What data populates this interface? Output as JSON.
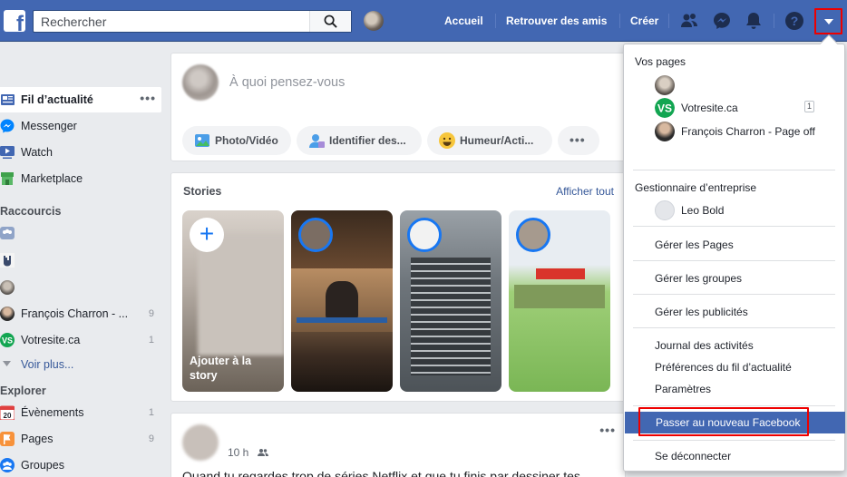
{
  "topbar": {
    "search_placeholder": "Rechercher",
    "nav": [
      "Accueil",
      "Retrouver des amis",
      "Créer"
    ],
    "icons": [
      "friends-icon",
      "messenger-icon",
      "bell-icon",
      "help-icon",
      "dropdown-arrow-icon"
    ],
    "brand_color": "#4267b2"
  },
  "sidebar": {
    "items": [
      {
        "label": "Fil d’actualité",
        "icon": "news-feed-icon"
      },
      {
        "label": "Messenger",
        "icon": "messenger-icon"
      },
      {
        "label": "Watch",
        "icon": "watch-icon"
      },
      {
        "label": "Marketplace",
        "icon": "marketplace-icon"
      }
    ],
    "shortcuts_title": "Raccourcis",
    "shortcuts": [
      {
        "label": "François Charron - ...",
        "count": "9"
      },
      {
        "label": "Votresite.ca",
        "count": "1"
      }
    ],
    "see_more": "Voir plus...",
    "explore_title": "Explorer",
    "explore": [
      {
        "label": "Évènements",
        "count": "1",
        "icon": "calendar-icon"
      },
      {
        "label": "Pages",
        "count": "9",
        "icon": "flag-icon"
      },
      {
        "label": "Groupes",
        "count": "",
        "icon": "groups-icon"
      }
    ]
  },
  "composer": {
    "placeholder": "À quoi pensez-vous",
    "actions": [
      "Photo/Vidéo",
      "Identifier des...",
      "Humeur/Acti..."
    ]
  },
  "stories": {
    "title": "Stories",
    "see_all": "Afficher tout",
    "add_label": "Ajouter à la story"
  },
  "post": {
    "time": "10 h",
    "text": "Quand tu regardes trop de séries Netflix et que tu finis par dessiner tes"
  },
  "menu": {
    "pages_title": "Vos pages",
    "pages": [
      {
        "label": "Votresite.ca",
        "badge": "1"
      },
      {
        "label": "François Charron - Page off",
        "badge": ""
      }
    ],
    "business_title": "Gestionnaire d’entreprise",
    "business_user": "Leo Bold",
    "items_1": [
      "Gérer les Pages"
    ],
    "items_2": [
      "Gérer les groupes"
    ],
    "items_3": [
      "Gérer les publicités"
    ],
    "items_4": [
      "Journal des activités",
      "Préférences du fil d’actualité",
      "Paramètres"
    ],
    "highlight": "Passer au nouveau Facebook",
    "logout": "Se déconnecter"
  }
}
